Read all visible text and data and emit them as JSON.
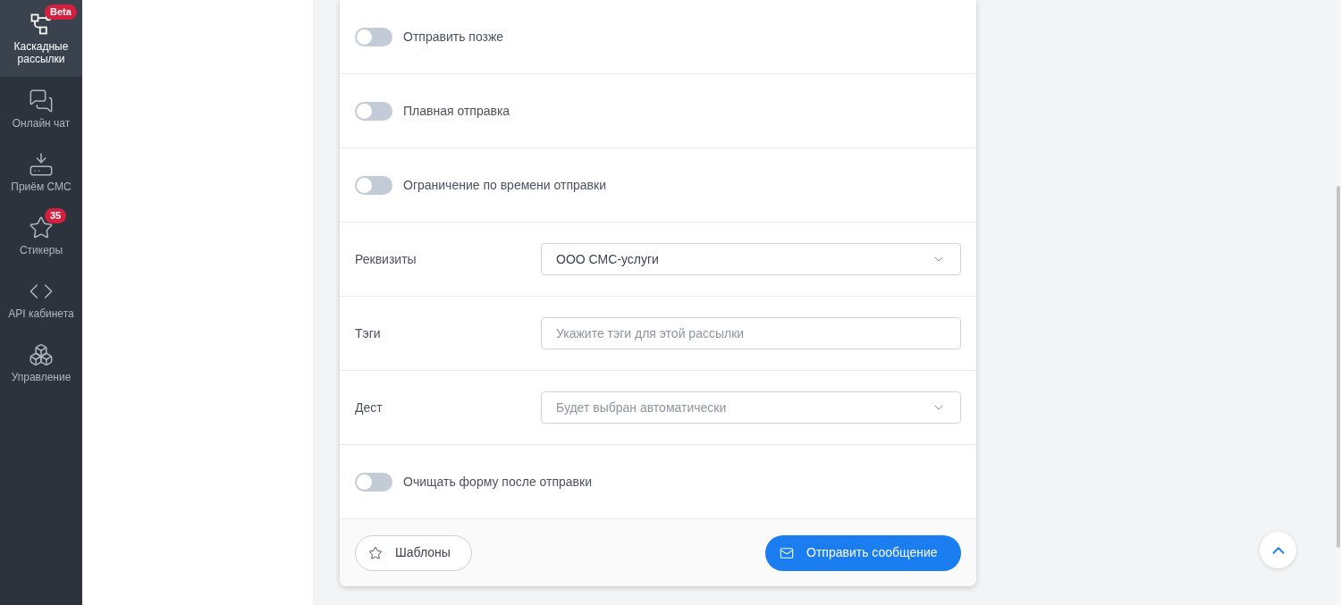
{
  "sidebar": {
    "items": [
      {
        "kind": "cascade",
        "label": "Каскадные рассылки",
        "selected": true,
        "badge": "Beta"
      },
      {
        "kind": "chat",
        "label": "Онлайн чат",
        "selected": false
      },
      {
        "kind": "inbox",
        "label": "Приём СМС",
        "selected": false
      },
      {
        "kind": "star",
        "label": "Стикеры",
        "selected": false,
        "badge": "35"
      },
      {
        "kind": "code",
        "label": "API кабинета",
        "selected": false
      },
      {
        "kind": "boxes",
        "label": "Управление",
        "selected": false
      }
    ]
  },
  "form": {
    "rows": [
      {
        "kind": "toggle",
        "label": "Отправить позже",
        "on": false
      },
      {
        "kind": "toggle",
        "label": "Плавная отправка",
        "on": false
      },
      {
        "kind": "toggle",
        "label": "Ограничение по времени отправки",
        "on": false
      },
      {
        "kind": "select",
        "label": "Реквизиты",
        "value": "ООО СМС-услуги"
      },
      {
        "kind": "input",
        "label": "Тэги",
        "placeholder": "Укажите тэги для этой рассылки"
      },
      {
        "kind": "select",
        "label": "Дест",
        "placeholder": "Будет выбран автоматически"
      },
      {
        "kind": "toggle",
        "label": "Очищать форму после отправки",
        "on": false
      }
    ],
    "footer": {
      "templates_button": "Шаблоны",
      "send_button": "Отправить сообщение"
    }
  }
}
